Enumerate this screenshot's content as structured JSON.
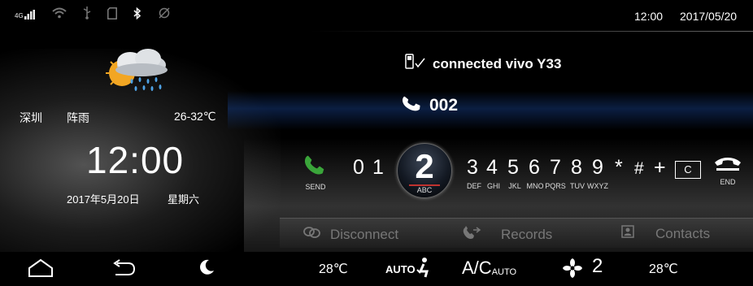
{
  "status_bar": {
    "signal_label": "4G",
    "time": "12:00",
    "date": "2017/05/20",
    "icons": [
      "signal-icon",
      "wifi-icon",
      "usb-icon",
      "sdcard-icon",
      "bluetooth-icon",
      "eye-off-icon"
    ]
  },
  "weather": {
    "city": "深圳",
    "condition": "阵雨",
    "temp_range": "26-32℃",
    "icon": "weather-shower-icon"
  },
  "clock": {
    "time": "12:00",
    "date": "2017年5月20日",
    "weekday": "星期六"
  },
  "phone": {
    "connected_text": "connected vivo Y33",
    "current_number": "002",
    "send_label": "SEND",
    "end_label": "END",
    "center_key": "2",
    "center_sub": "ABC",
    "keys": [
      {
        "key": "0",
        "sub": ""
      },
      {
        "key": "1",
        "sub": ""
      },
      {
        "key": "3",
        "sub": "DEF"
      },
      {
        "key": "4",
        "sub": "GHI"
      },
      {
        "key": "5",
        "sub": "JKL"
      },
      {
        "key": "6",
        "sub": "MNO"
      },
      {
        "key": "7",
        "sub": "PQRS"
      },
      {
        "key": "8",
        "sub": "TUV"
      },
      {
        "key": "9",
        "sub": "WXYZ"
      },
      {
        "key": "*",
        "sub": ""
      },
      {
        "key": "#",
        "sub": ""
      },
      {
        "key": "+",
        "sub": ""
      }
    ],
    "clear_key": "C"
  },
  "actions": {
    "disconnect": "Disconnect",
    "records": "Records",
    "contacts": "Contacts"
  },
  "bottom_bar": {
    "left_temp": "28℃",
    "auto_label": "AUTO",
    "ac_label": "A/C",
    "ac_sub": "AUTO",
    "fan_level": "2",
    "right_temp": "28℃"
  },
  "colors": {
    "accent_green": "#3aa53a",
    "accent_red": "#c0322f",
    "highlight_blue": "#143778"
  }
}
